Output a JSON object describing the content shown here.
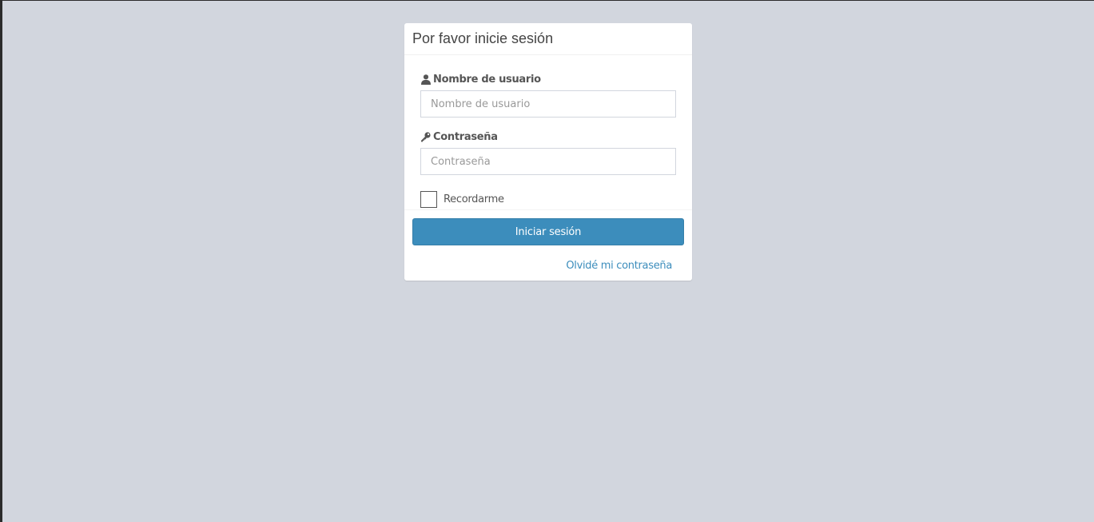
{
  "colors": {
    "background": "#d2d6de",
    "primary": "#3c8dbc",
    "text": "#555555"
  },
  "login": {
    "title": "Por favor inicie sesión",
    "username": {
      "icon": "user-icon",
      "label": "Nombre de usuario",
      "placeholder": "Nombre de usuario",
      "value": ""
    },
    "password": {
      "icon": "key-icon",
      "label": "Contraseña",
      "placeholder": "Contraseña",
      "value": ""
    },
    "remember": {
      "label": "Recordarme",
      "checked": false
    },
    "submit_label": "Iniciar sesión",
    "forgot_label": "Olvidé mi contraseña"
  }
}
